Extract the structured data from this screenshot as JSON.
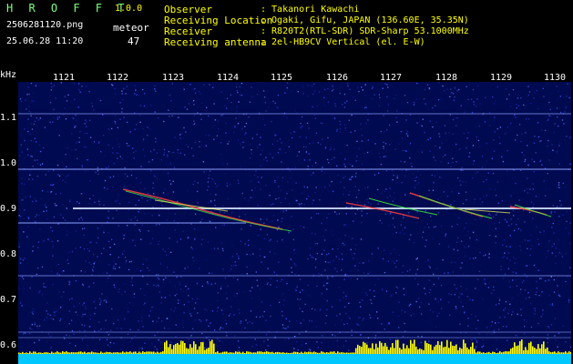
{
  "header": {
    "app_title": "H R O F F T",
    "app_version": "1.0.0",
    "file_name": "2506281120.png",
    "timestamp": "25.06.28 11:20",
    "meteor_label": "meteor",
    "meteor_count": "47"
  },
  "info": [
    {
      "label": "Observer",
      "value": ": Takanori Kawachi"
    },
    {
      "label": "Receiving Location",
      "value": ": Ogaki, Gifu, JAPAN (136.60E, 35.35N)"
    },
    {
      "label": "Receiver",
      "value": ": R820T2(RTL-SDR) SDR-Sharp 53.1000MHz"
    },
    {
      "label": "Receiving antenna",
      "value": ": 2el-HB9CV Vertical (el. E-W)"
    }
  ],
  "axis": {
    "y_unit": "kHz",
    "x_ticks": [
      "1121",
      "1122",
      "1123",
      "1124",
      "1125",
      "1126",
      "1127",
      "1128",
      "1129",
      "1130"
    ],
    "y_ticks": [
      "1.1",
      "1.0",
      "0.9",
      "0.8",
      "0.7",
      "0.6"
    ]
  },
  "colors": {
    "background": "#000000",
    "spectrogram": "#000a50",
    "header_text": "#ffff00",
    "title_text": "#7dff7d",
    "baseline": "#00c8ff",
    "activity": "#ffff00"
  }
}
